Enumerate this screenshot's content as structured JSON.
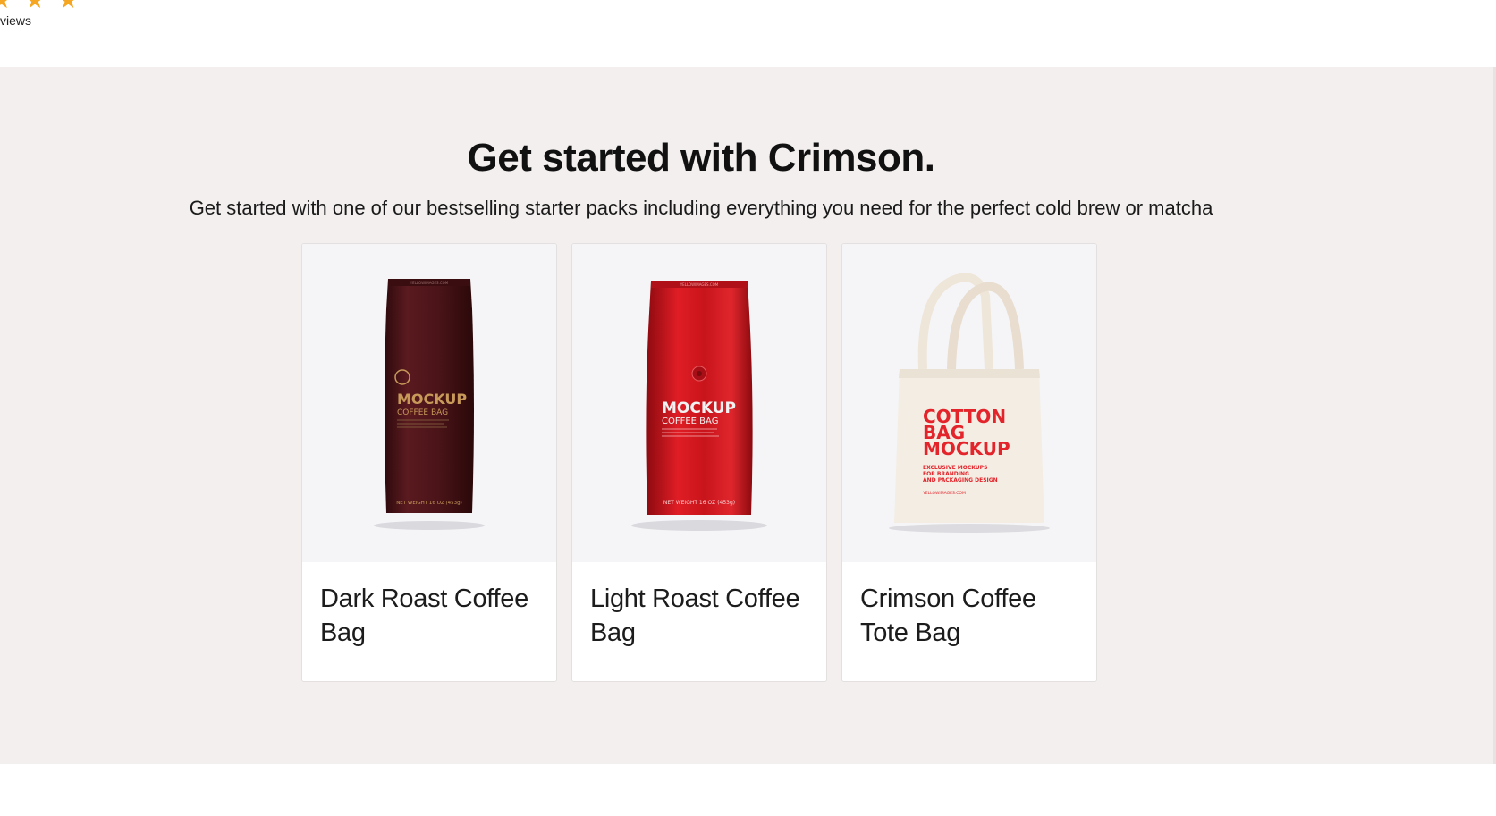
{
  "reviews": {
    "stars": [
      "★",
      "★",
      "★"
    ],
    "label": "views"
  },
  "section": {
    "headline": "Get started with Crimson.",
    "subline": "Get started with one of our bestselling starter packs including everything you need for the perfect cold brew or matcha"
  },
  "products": [
    {
      "title": "Dark Roast Coffee Bag",
      "bag_color": "#4a1418",
      "label_color": "#c79a5a",
      "label_main": "MOCKUP",
      "label_sub": "COFFEE BAG",
      "brand_top": "YELLOWIMAGES.COM",
      "weight": "NET WEIGHT 16 OZ (453g)"
    },
    {
      "title": "Light Roast Coffee Bag",
      "bag_color": "#c8141b",
      "label_color": "#f2f2f2",
      "label_main": "MOCKUP",
      "label_sub": "COFFEE BAG",
      "brand_top": "YELLOWIMAGES.COM",
      "weight": "NET WEIGHT 16 OZ (453g)"
    },
    {
      "title": "Crimson Coffee Tote Bag",
      "bag_color": "#f4ede3",
      "label_color": "#e3242b",
      "label_lines": [
        "COTTON",
        "BAG",
        "MOCKUP"
      ],
      "label_small": [
        "EXCLUSIVE MOCKUPS",
        "FOR BRANDING",
        "AND PACKAGING DESIGN"
      ],
      "brand": "YELLOWIMAGES.COM"
    }
  ]
}
